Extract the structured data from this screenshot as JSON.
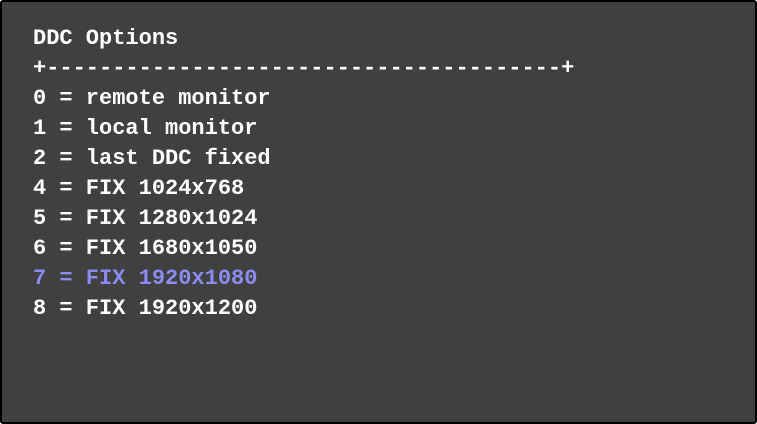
{
  "menu": {
    "title": "DDC Options",
    "separator": "+---------------------------------------+",
    "items": [
      {
        "label": "0 = remote monitor",
        "selected": false
      },
      {
        "label": "1 = local monitor",
        "selected": false
      },
      {
        "label": "2 = last DDC fixed",
        "selected": false
      },
      {
        "label": "4 = FIX 1024x768",
        "selected": false
      },
      {
        "label": "5 = FIX 1280x1024",
        "selected": false
      },
      {
        "label": "6 = FIX 1680x1050",
        "selected": false
      },
      {
        "label": "7 = FIX 1920x1080",
        "selected": true
      },
      {
        "label": "8 = FIX 1920x1200",
        "selected": false
      }
    ]
  },
  "colors": {
    "background": "#404040",
    "text": "#ffffff",
    "selected": "#8a8cf0",
    "border": "#000000"
  }
}
